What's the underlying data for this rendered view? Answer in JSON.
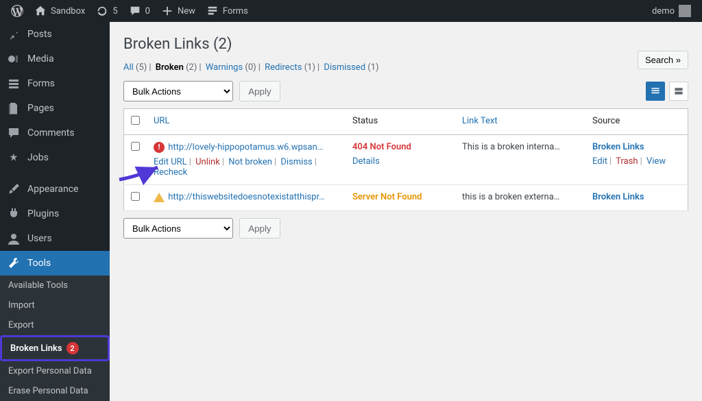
{
  "adminbar": {
    "site": "Sandbox",
    "updates": "5",
    "comments": "0",
    "new": "New",
    "forms": "Forms",
    "user": "demo"
  },
  "sidebar": {
    "items": [
      {
        "label": "Posts"
      },
      {
        "label": "Media"
      },
      {
        "label": "Forms"
      },
      {
        "label": "Pages"
      },
      {
        "label": "Comments"
      },
      {
        "label": "Jobs"
      },
      {
        "label": "Appearance"
      },
      {
        "label": "Plugins"
      },
      {
        "label": "Users"
      },
      {
        "label": "Tools"
      }
    ],
    "tools_sub": [
      {
        "label": "Available Tools"
      },
      {
        "label": "Import"
      },
      {
        "label": "Export"
      },
      {
        "label": "Broken Links",
        "badge": "2"
      },
      {
        "label": "Export Personal Data"
      },
      {
        "label": "Erase Personal Data"
      }
    ]
  },
  "page": {
    "title": "Broken Links (2)",
    "search": "Search »",
    "bulk_label": "Bulk Actions",
    "apply": "Apply",
    "filters": {
      "all": {
        "label": "All",
        "count": "(5)"
      },
      "broken": {
        "label": "Broken",
        "count": "(2)"
      },
      "warnings": {
        "label": "Warnings",
        "count": "(0)"
      },
      "redirects": {
        "label": "Redirects",
        "count": "(1)"
      },
      "dismissed": {
        "label": "Dismissed",
        "count": "(1)"
      }
    },
    "columns": {
      "url": "URL",
      "status": "Status",
      "linktext": "Link Text",
      "source": "Source"
    }
  },
  "rows": [
    {
      "url": "http://lovely-hippopotamus.w6.wpsan…",
      "status": "404 Not Found",
      "status_class": "status-404",
      "details": "Details",
      "linktext": "This is a broken interna…",
      "source": "Broken Links",
      "actions_url": {
        "edit": "Edit URL",
        "unlink": "Unlink",
        "notbroken": "Not broken",
        "dismiss": "Dismiss",
        "recheck": "Recheck"
      },
      "actions_src": {
        "edit": "Edit",
        "trash": "Trash",
        "view": "View"
      }
    },
    {
      "url": "http://thiswebsitedoesnotexistatthispr…",
      "status": "Server Not Found",
      "status_class": "status-svr",
      "linktext": "this is a broken externa…",
      "source": "Broken Links"
    }
  ]
}
